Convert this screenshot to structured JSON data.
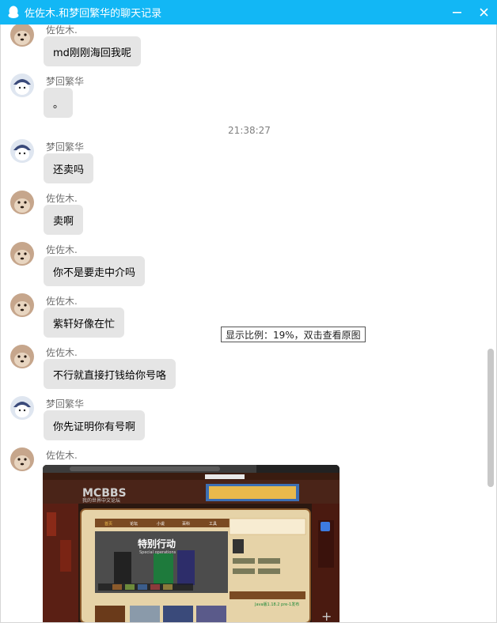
{
  "window": {
    "title": "佐佐木.和梦回繁华的聊天记录",
    "icon": "qq-penguin-icon",
    "accent": "#12b7f5"
  },
  "messages": [
    {
      "sender": "佐佐木.",
      "text": "md刚刚海回我呢"
    },
    {
      "sender": "梦回繁华",
      "text": "。"
    },
    {
      "timestamp": "21:38:27"
    },
    {
      "sender": "梦回繁华",
      "text": "还卖吗"
    },
    {
      "sender": "佐佐木.",
      "text": "卖啊"
    },
    {
      "sender": "佐佐木.",
      "text": "你不是要走中介吗"
    },
    {
      "sender": "佐佐木.",
      "text": "紫轩好像在忙"
    },
    {
      "sender": "佐佐木.",
      "text": "不行就直接打钱给你号咯"
    },
    {
      "sender": "梦回繁华",
      "text": "你先证明你有号啊"
    },
    {
      "sender": "佐佐木.",
      "image": "mcbbs-website-screenshot"
    }
  ],
  "zoom_tip": "显示比例：19%，双击查看原图",
  "embedded_image": {
    "logo": "MCBBS",
    "subtitle": "我的世界中文论坛",
    "banner": "特别行动",
    "banner_sub": "Special operations",
    "nav": [
      "首页",
      "论坛",
      "小说",
      "百科",
      "工具"
    ],
    "news": "Java版1.18.2 pre-1发布"
  }
}
